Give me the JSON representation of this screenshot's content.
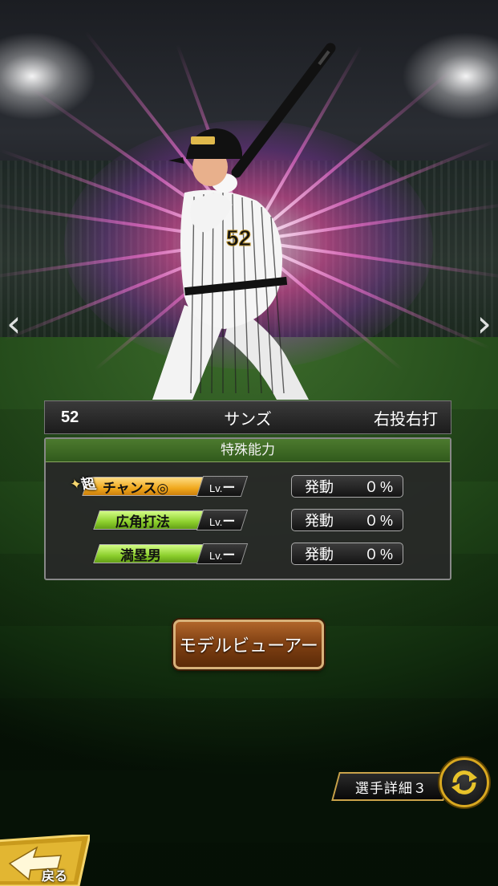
{
  "player": {
    "number": "52",
    "name": "サンズ",
    "handedness": "右投右打"
  },
  "nav": {
    "prev_icon": "chevron-left-icon",
    "next_icon": "chevron-right-icon"
  },
  "abilities": {
    "header": "特殊能力",
    "items": [
      {
        "badge": "超",
        "name": "チャンス◎",
        "level_prefix": "Lv.",
        "level": "ー",
        "status_label": "発動",
        "percent": "０%",
        "color": "gold"
      },
      {
        "badge": "",
        "name": "広角打法",
        "level_prefix": "Lv.",
        "level": "ー",
        "status_label": "発動",
        "percent": "０%",
        "color": "green"
      },
      {
        "badge": "",
        "name": "満塁男",
        "level_prefix": "Lv.",
        "level": "ー",
        "status_label": "発動",
        "percent": "０%",
        "color": "green"
      }
    ]
  },
  "buttons": {
    "model_viewer": "モデルビューアー",
    "player_detail": "選手詳細３",
    "back": "戻る"
  },
  "colors": {
    "gold_skill": "#f0a81c",
    "green_skill": "#8ccf2c",
    "panel_header": "#4c7a2e",
    "button_brown": "#7e3f12"
  }
}
